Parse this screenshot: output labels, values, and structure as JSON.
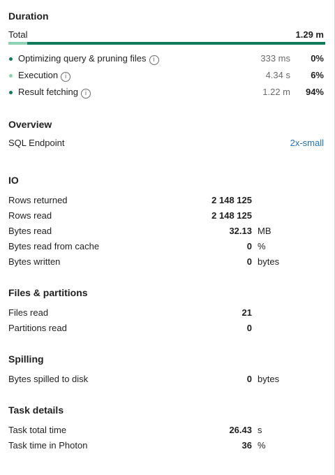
{
  "duration": {
    "heading": "Duration",
    "total_label": "Total",
    "total_value": "1.29 m",
    "bar_fraction_first_segment": 0.06,
    "items": [
      {
        "label": "Optimizing query & pruning files",
        "time": "333 ms",
        "pct": "0%",
        "dot_color": "#0f7a5c"
      },
      {
        "label": "Execution",
        "time": "4.34 s",
        "pct": "6%",
        "dot_color": "#8fd1b3"
      },
      {
        "label": "Result fetching",
        "time": "1.22 m",
        "pct": "94%",
        "dot_color": "#0f7a5c"
      }
    ],
    "info_icon": "info-circle-icon"
  },
  "overview": {
    "heading": "Overview",
    "endpoint_label": "SQL Endpoint",
    "endpoint_value": "2x-small"
  },
  "io": {
    "heading": "IO",
    "rows": [
      {
        "label": "Rows returned",
        "value": "2 148 125",
        "unit": ""
      },
      {
        "label": "Rows read",
        "value": "2 148 125",
        "unit": ""
      },
      {
        "label": "Bytes read",
        "value": "32.13",
        "unit": "MB"
      },
      {
        "label": "Bytes read from cache",
        "value": "0",
        "unit": "%"
      },
      {
        "label": "Bytes written",
        "value": "0",
        "unit": "bytes"
      }
    ]
  },
  "files": {
    "heading": "Files & partitions",
    "rows": [
      {
        "label": "Files read",
        "value": "21",
        "unit": ""
      },
      {
        "label": "Partitions read",
        "value": "0",
        "unit": ""
      }
    ]
  },
  "spilling": {
    "heading": "Spilling",
    "rows": [
      {
        "label": "Bytes spilled to disk",
        "value": "0",
        "unit": "bytes"
      }
    ]
  },
  "task": {
    "heading": "Task details",
    "rows": [
      {
        "label": "Task total time",
        "value": "26.43",
        "unit": "s"
      },
      {
        "label": "Task time in Photon",
        "value": "36",
        "unit": "%"
      }
    ]
  },
  "colors": {
    "accent": "#0f7a5c",
    "accent_light": "#8fd1b3",
    "link": "#2272b4"
  }
}
